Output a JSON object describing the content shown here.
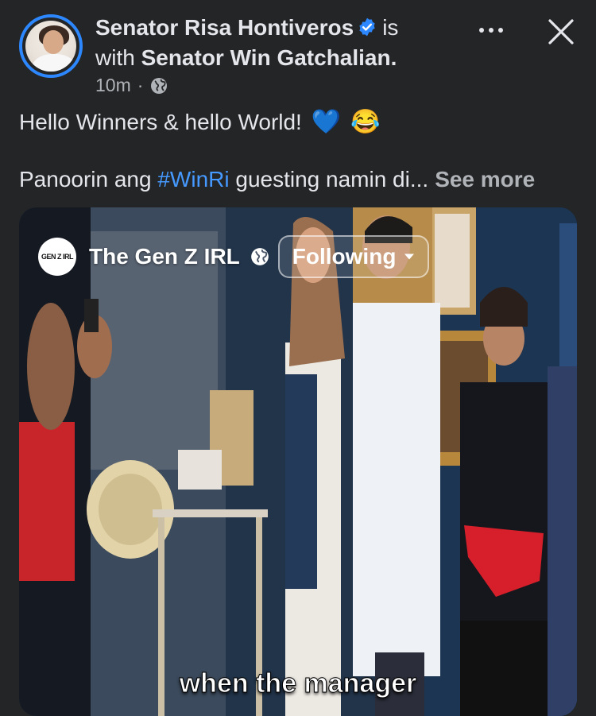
{
  "post": {
    "author": "Senator Risa Hontiveros",
    "with_prefix": "is",
    "with_word": "with",
    "tagged": "Senator Win Gatchalian.",
    "time": "10m",
    "separator": "·",
    "text_line1": "Hello Winners & hello World!",
    "emoji_heart": "💙",
    "emoji_laugh": "😂",
    "text_line2_before": "Panoorin ang ",
    "hashtag": "#WinRi",
    "text_line2_after": " guesting namin di...",
    "see_more": "See more"
  },
  "video": {
    "page_logo_text": "GEN Z IRL",
    "page_name": "The Gen Z IRL",
    "follow_label": "Following",
    "caption": "when the manager"
  },
  "colors": {
    "background": "#242526",
    "text": "#e4e6eb",
    "muted": "#b0b3b8",
    "hashtag": "#4599ff",
    "verified": "#2d88ff"
  },
  "icons": [
    "verified-badge-icon",
    "globe-icon",
    "more-icon",
    "close-icon",
    "chevron-down-icon"
  ]
}
